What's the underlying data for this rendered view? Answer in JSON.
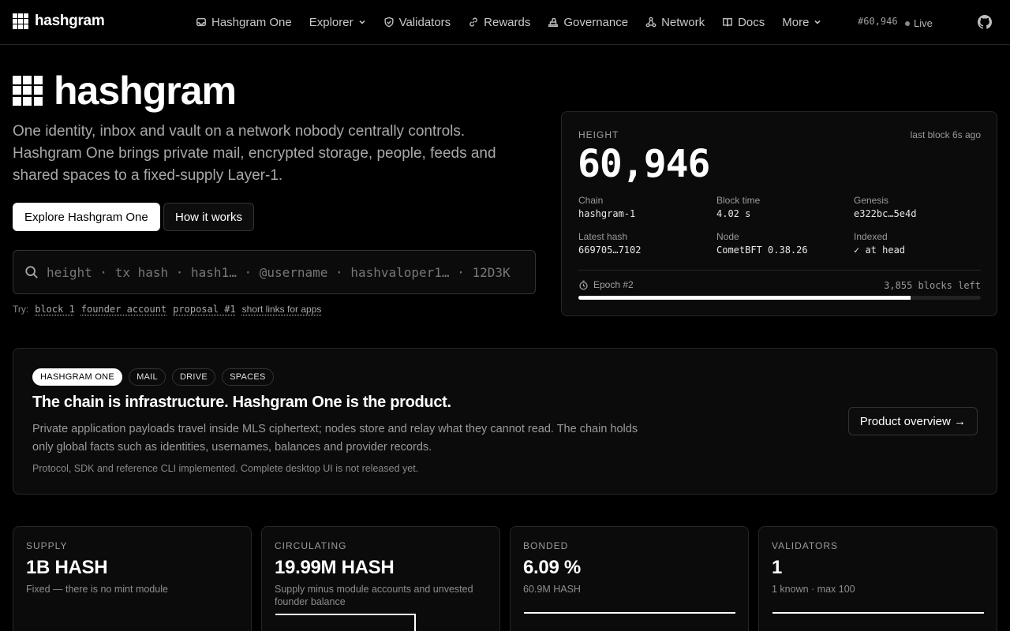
{
  "brand": {
    "name": "hashgram"
  },
  "nav": {
    "items": [
      {
        "label": "Hashgram One",
        "icon": "inbox-icon"
      },
      {
        "label": "Explorer",
        "icon": "",
        "dropdown": true
      },
      {
        "label": "Validators",
        "icon": "shield-icon"
      },
      {
        "label": "Rewards",
        "icon": "link-icon"
      },
      {
        "label": "Governance",
        "icon": "ballot-icon"
      },
      {
        "label": "Network",
        "icon": "network-icon"
      },
      {
        "label": "Docs",
        "icon": "book-icon"
      },
      {
        "label": "More",
        "icon": "",
        "dropdown": true
      }
    ],
    "height_badge": "#60,946",
    "live_label": "Live",
    "github_icon": "github-icon"
  },
  "hero": {
    "title": "hashgram",
    "description": "One identity, inbox and vault on a network nobody centrally controls. Hashgram One brings private mail, encrypted storage, people, feeds and shared spaces to a fixed-supply Layer-1.",
    "primary_button": "Explore Hashgram One",
    "secondary_button": "How it works",
    "search_placeholder": "height · tx hash · hash1… · @username · hashvaloper1… · 12D3K",
    "try_label": "Try:",
    "try_links": [
      "block 1",
      "founder account",
      "proposal #1",
      "short links for apps"
    ]
  },
  "height_card": {
    "label": "HEIGHT",
    "last_block": "last block 6s ago",
    "height": "60,946",
    "fields": [
      {
        "key": "Chain",
        "value": "hashgram-1"
      },
      {
        "key": "Block time",
        "value": "4.02 s"
      },
      {
        "key": "Genesis",
        "value": "e322bc…5e4d"
      },
      {
        "key": "Latest hash",
        "value": "669705…7102"
      },
      {
        "key": "Node",
        "value": "CometBFT 0.38.26"
      },
      {
        "key": "Indexed",
        "value": "✓ at head"
      }
    ],
    "epoch_label": "Epoch #2",
    "blocks_left": "3,855 blocks left",
    "epoch_progress": 0.825
  },
  "product": {
    "pills": [
      "HASHGRAM ONE",
      "MAIL",
      "DRIVE",
      "SPACES"
    ],
    "title": "The chain is infrastructure. Hashgram One is the product.",
    "description": "Private application payloads travel inside MLS ciphertext; nodes store and relay what they cannot read. The chain holds only global facts such as identities, usernames, balances and provider records.",
    "note": "Protocol, SDK and reference CLI implemented. Complete desktop UI is not released yet.",
    "button": "Product overview →"
  },
  "stats": [
    {
      "label": "SUPPLY",
      "value": "1B HASH",
      "sub": "Fixed — there is no mint module"
    },
    {
      "label": "CIRCULATING",
      "value": "19.99M HASH",
      "sub": "Supply minus module accounts and unvested founder balance"
    },
    {
      "label": "BONDED",
      "value": "6.09 %",
      "sub": "60.9M HASH"
    },
    {
      "label": "VALIDATORS",
      "value": "1",
      "sub": "1 known · max 100"
    }
  ]
}
